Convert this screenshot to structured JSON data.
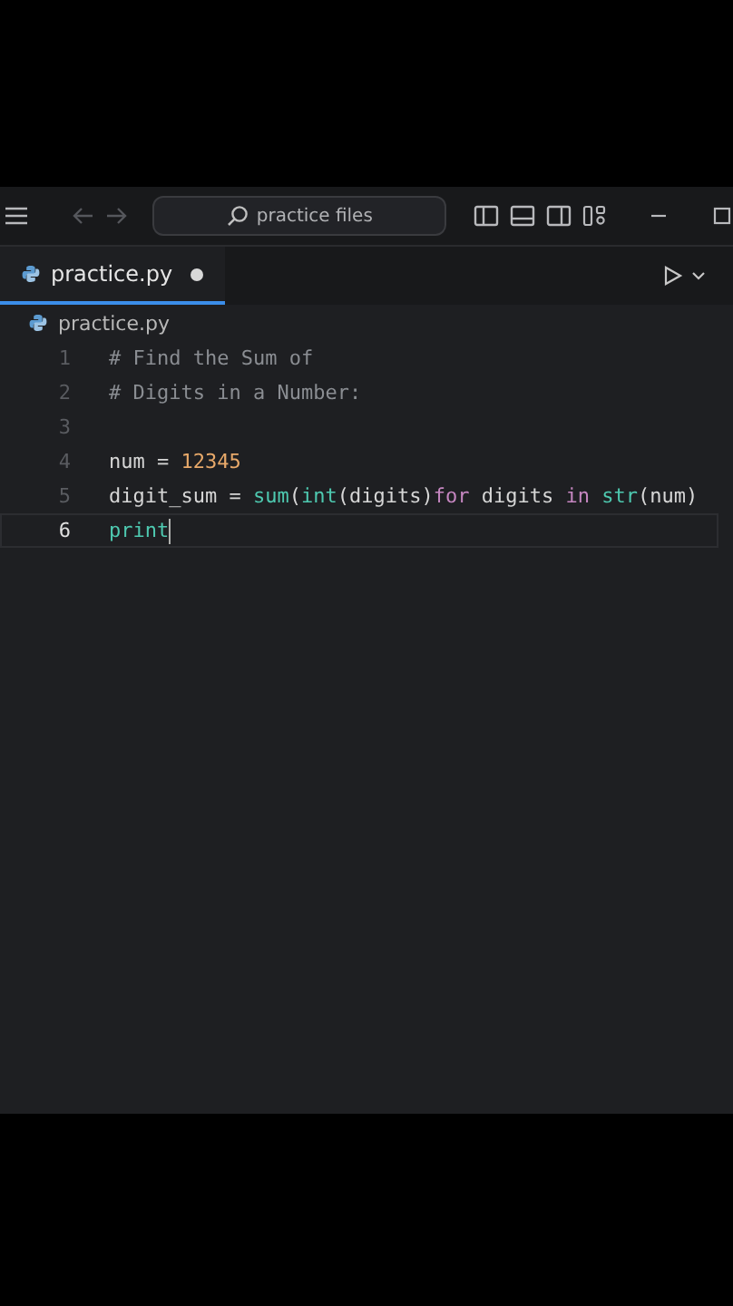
{
  "title_bar": {
    "search": {
      "placeholder": "practice files"
    },
    "back_disabled": true,
    "forward_disabled": true
  },
  "tabs": [
    {
      "label": "practice.py",
      "selected": true,
      "modified": true
    }
  ],
  "breadcrumb": [
    "practice.py"
  ],
  "editor": {
    "lines": [
      {
        "number": "1",
        "current": false,
        "tokens": [
          {
            "text": "# Find the Sum of",
            "kind": "comment"
          }
        ]
      },
      {
        "number": "2",
        "current": false,
        "tokens": [
          {
            "text": "# Digits in a Number:",
            "kind": "comment"
          }
        ]
      },
      {
        "number": "3",
        "current": false
      },
      {
        "number": "4",
        "current": false,
        "tokens": [
          {
            "text": "num = ",
            "kind": "plain"
          },
          {
            "text": "12345",
            "kind": "number"
          }
        ]
      },
      {
        "number": "5",
        "current": false,
        "tokens": [
          {
            "text": "digit_sum = ",
            "kind": "plain"
          },
          {
            "text": "sum",
            "kind": "builtin"
          },
          {
            "text": "(",
            "kind": "plain"
          },
          {
            "text": "int",
            "kind": "builtin"
          },
          {
            "text": "(digits)",
            "kind": "plain"
          },
          {
            "text": "for",
            "kind": "keyword"
          },
          {
            "text": " digits ",
            "kind": "plain"
          },
          {
            "text": "in ",
            "kind": "keyword"
          },
          {
            "text": "str",
            "kind": "builtin"
          },
          {
            "text": "(num)",
            "kind": "plain"
          }
        ]
      },
      {
        "number": "6",
        "current": true,
        "tokens": [
          {
            "text": "print",
            "kind": "builtin"
          }
        ]
      }
    ]
  }
}
